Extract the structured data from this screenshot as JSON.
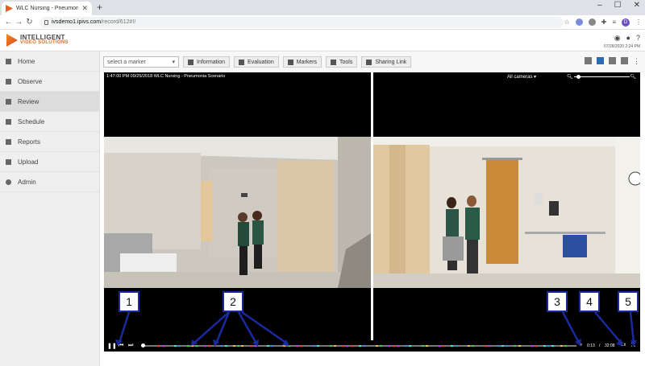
{
  "browser": {
    "tab_title": "WLC Nursing - Pneumonia S",
    "url_host": "ivsdemo1.ipivs.com",
    "url_path": "/record/612#!/",
    "profile_initial": "D"
  },
  "header": {
    "logo_line1": "INTELLIGENT",
    "logo_line2": "VIDEO SOLUTIONS",
    "datetime": "07/28/2020 2:24 PM"
  },
  "sidebar": {
    "items": [
      {
        "label": "Home",
        "icon": "home-icon",
        "active": false
      },
      {
        "label": "Observe",
        "icon": "camera-icon",
        "active": false
      },
      {
        "label": "Review",
        "icon": "film-icon",
        "active": true
      },
      {
        "label": "Schedule",
        "icon": "calendar-icon",
        "active": false
      },
      {
        "label": "Reports",
        "icon": "bar-chart-icon",
        "active": false
      },
      {
        "label": "Upload",
        "icon": "upload-icon",
        "active": false
      },
      {
        "label": "Admin",
        "icon": "gear-icon",
        "active": false
      }
    ]
  },
  "toolbar": {
    "marker_placeholder": "select a marker",
    "buttons": [
      {
        "label": "Information",
        "icon": "document-icon"
      },
      {
        "label": "Evaluation",
        "icon": "checkbox-icon"
      },
      {
        "label": "Markers",
        "icon": "bookmark-icon"
      },
      {
        "label": "Tools",
        "icon": "scissors-icon"
      },
      {
        "label": "Sharing Link",
        "icon": "link-icon"
      }
    ]
  },
  "player": {
    "timestamp": "1:47:00 PM 09/25/2018 WLC Nursing - Pneumonia Scenario",
    "camera_select": "All cameras",
    "current_time": "0:13",
    "total_time": "32:08",
    "speed": "1x",
    "timeline_position": 0.0,
    "marker_colors": [
      "#3ecf4a",
      "#e83b3b",
      "#3b8ee8",
      "#e8c23b",
      "#c23be8",
      "#3be8d9"
    ]
  },
  "callouts": [
    "1",
    "2",
    "3",
    "4",
    "5"
  ],
  "colors": {
    "accent": "#2d6ab6",
    "brand_orange": "#e36f1e",
    "callout_border": "#1a2a9e"
  }
}
